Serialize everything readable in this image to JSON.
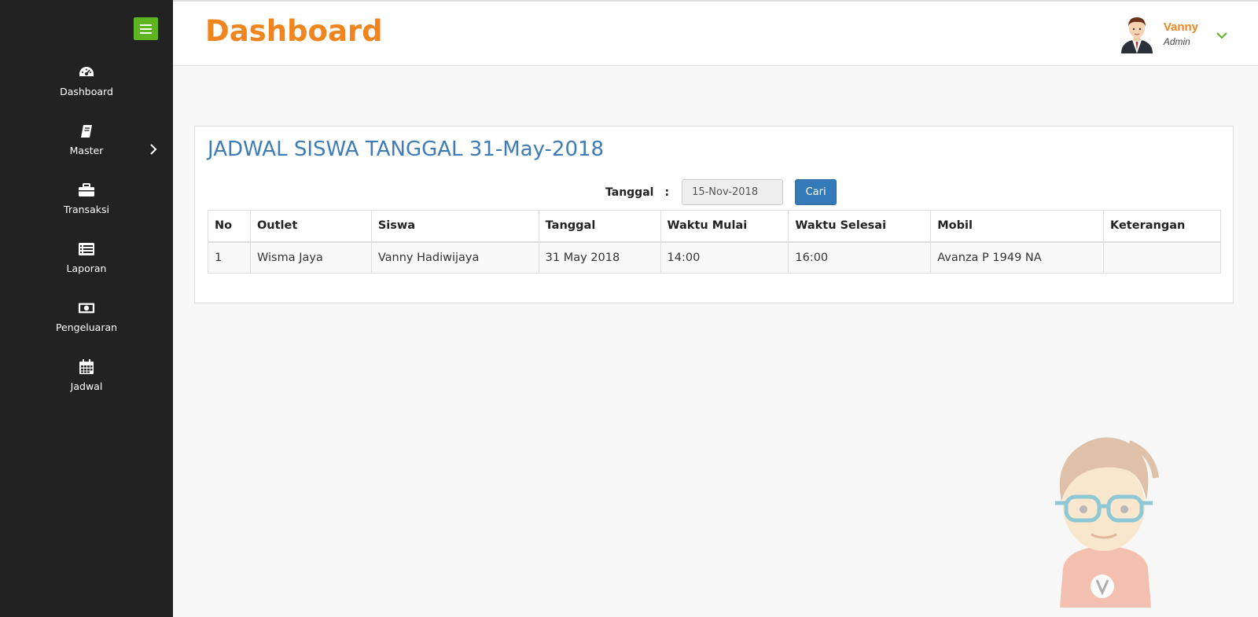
{
  "sidebar": {
    "toggle_icon": "hamburger-icon",
    "items": [
      {
        "label": "Dashboard",
        "icon": "dashboard-icon"
      },
      {
        "label": "Master",
        "icon": "book-icon"
      },
      {
        "label": "Transaksi",
        "icon": "briefcase-icon"
      },
      {
        "label": "Laporan",
        "icon": "list-icon"
      },
      {
        "label": "Pengeluaran",
        "icon": "money-icon"
      },
      {
        "label": "Jadwal",
        "icon": "calendar-icon"
      }
    ]
  },
  "header": {
    "title": "Dashboard",
    "user": {
      "name": "Vanny",
      "role": "Admin"
    }
  },
  "main": {
    "panel_title": "JADWAL SISWA TANGGAL 31-May-2018",
    "search": {
      "label": "Tanggal",
      "colon": ":",
      "value": "15-Nov-2018",
      "button": "Cari"
    },
    "table": {
      "columns": [
        "No",
        "Outlet",
        "Siswa",
        "Tanggal",
        "Waktu Mulai",
        "Waktu Selesai",
        "Mobil",
        "Keterangan"
      ],
      "rows": [
        [
          "1",
          "Wisma Jaya",
          "Vanny Hadiwijaya",
          "31 May 2018",
          "14:00",
          "16:00",
          "Avanza P 1949 NA",
          ""
        ]
      ]
    }
  },
  "colors": {
    "accent": "#f0851f",
    "sidebar_bg": "#222222",
    "toggle_bg": "#5eb51f",
    "title_blue": "#3e7bb7",
    "button_blue": "#337ab7"
  }
}
